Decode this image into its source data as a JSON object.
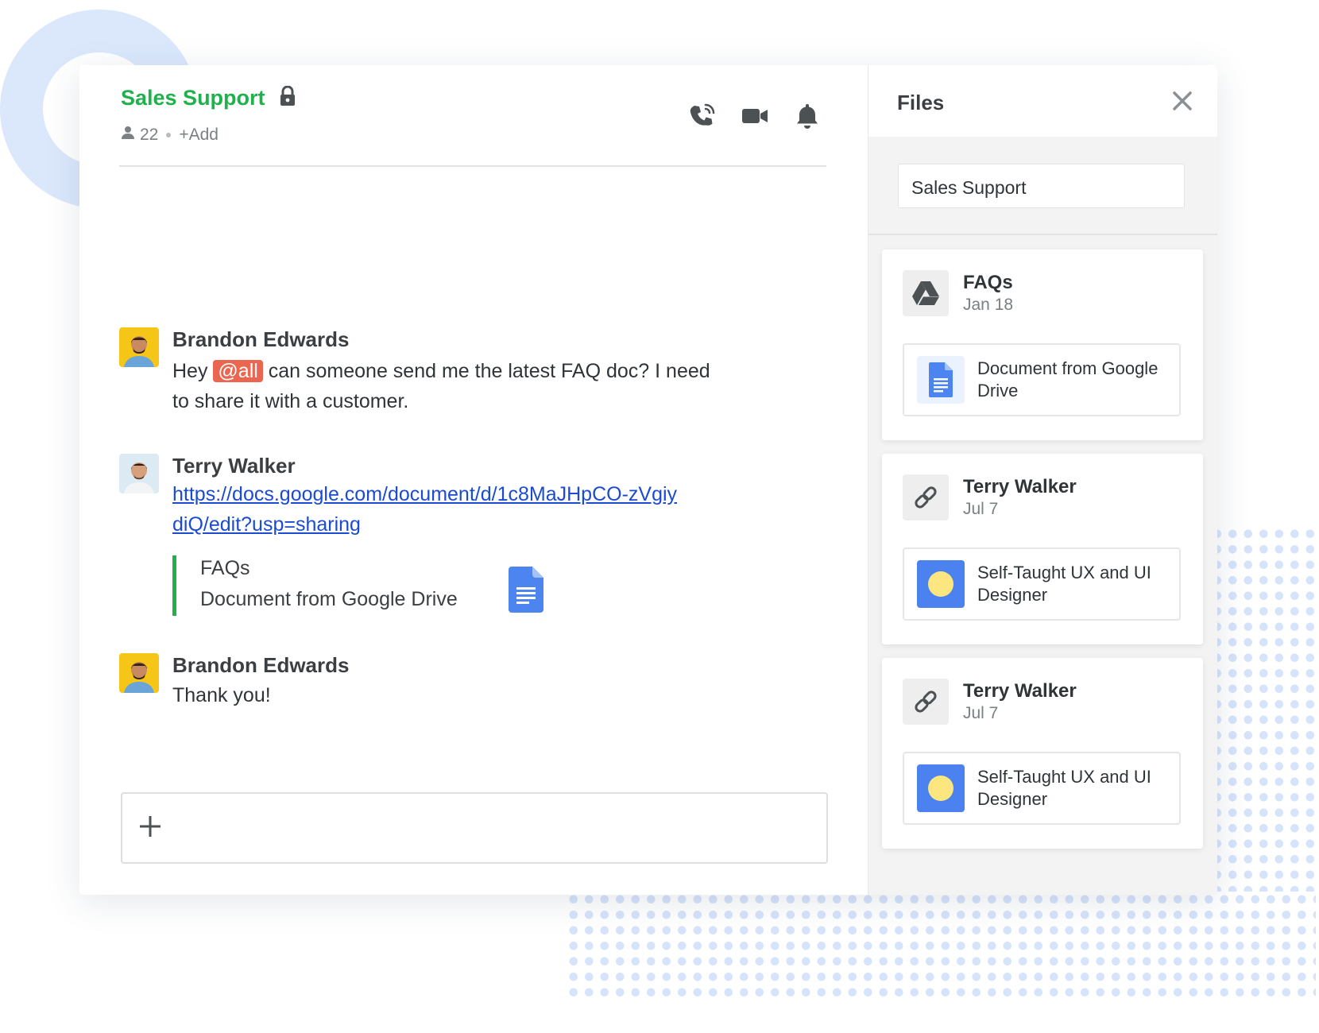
{
  "colors": {
    "accent_green": "#1fb14c",
    "mention_bg": "#ea6650",
    "link_blue": "#1a4bd1",
    "doc_blue": "#4c85f0"
  },
  "header": {
    "title": "Sales Support",
    "lock_icon": "lock-icon",
    "member_count": "22",
    "add_label": "+Add",
    "icons": [
      "phone-icon",
      "video-icon",
      "bell-icon"
    ]
  },
  "messages": [
    {
      "sender": "Brandon Edwards",
      "text_before": "Hey",
      "mention": "@all",
      "text_after": "can someone send me the latest FAQ doc? I need to share it with a customer."
    },
    {
      "sender": "Terry Walker",
      "link": "https://docs.google.com/document/d/1c8MaJHpCO-zVgiydiQ/edit?usp=sharing",
      "preview": {
        "title": "FAQs",
        "subtitle": "Document from Google Drive"
      }
    },
    {
      "sender": "Brandon Edwards",
      "text": "Thank you!"
    }
  ],
  "composer": {
    "add_icon": "plus-icon"
  },
  "files_panel": {
    "title": "Files",
    "close_icon": "close-icon",
    "search_value": "Sales Support",
    "cards": [
      {
        "title": "FAQs",
        "date": "Jan 18",
        "icon": "google-drive-icon",
        "item": "Document from Google Drive",
        "thumb": "google-doc-icon"
      },
      {
        "title": "Terry Walker",
        "date": "Jul 7",
        "icon": "link-icon",
        "item": "Self-Taught UX and UI Designer",
        "thumb": "ux-thumbnail"
      },
      {
        "title": "Terry Walker",
        "date": "Jul 7",
        "icon": "link-icon",
        "item": "Self-Taught UX and UI Designer",
        "thumb": "ux-thumbnail"
      }
    ]
  }
}
